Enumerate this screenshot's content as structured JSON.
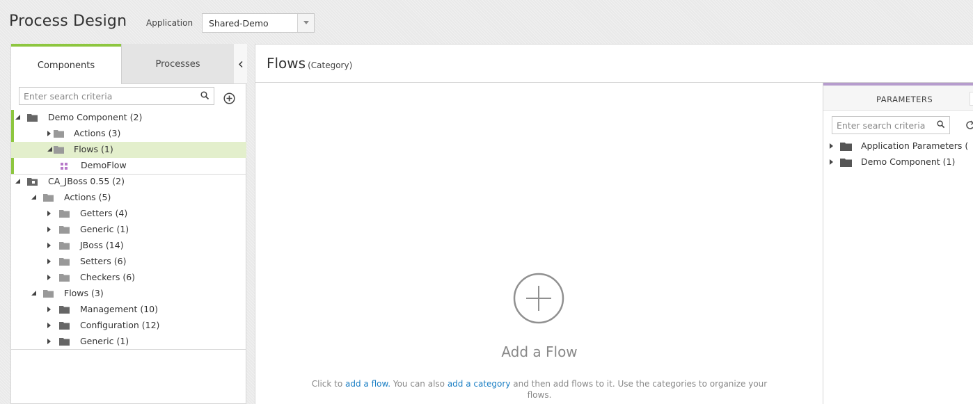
{
  "header": {
    "title": "Process Design",
    "application_label": "Application",
    "application_value": "Shared-Demo"
  },
  "left_panel": {
    "tabs": {
      "components": "Components",
      "processes": "Processes"
    },
    "search_placeholder": "Enter search criteria",
    "tree": {
      "demo_component": "Demo Component (2)",
      "demo_actions": "Actions (3)",
      "demo_flows": "Flows (1)",
      "demo_flow_item": "DemoFlow",
      "jboss": "CA_JBoss 0.55 (2)",
      "jboss_actions": "Actions (5)",
      "getters": "Getters (4)",
      "generic_actions": "Generic (1)",
      "jboss_sub": "JBoss (14)",
      "setters": "Setters (6)",
      "checkers": "Checkers (6)",
      "jboss_flows": "Flows (3)",
      "management": "Management (10)",
      "configuration": "Configuration (12)",
      "generic_flows": "Generic (1)"
    }
  },
  "main": {
    "title": "Flows",
    "subtitle": "(Category)",
    "empty_title": "Add a Flow",
    "empty_text": {
      "prefix": "Click to ",
      "link_flow": "add a flow.",
      "middle": " You can also ",
      "link_category": "add a category",
      "suffix": " and then add flows to it. Use the categories to organize your flows."
    }
  },
  "parameters": {
    "tab_label": "PARAMETERS",
    "search_placeholder": "Enter search criteria",
    "items": [
      "Application Parameters (",
      "Demo Component (1)"
    ]
  },
  "colors": {
    "accent_green": "#8dc63f",
    "selected_row": "#e3efcc",
    "parameters_accent": "#b69ccd",
    "link_blue": "#1b7fc4",
    "flow_icon": "#b779c9"
  }
}
